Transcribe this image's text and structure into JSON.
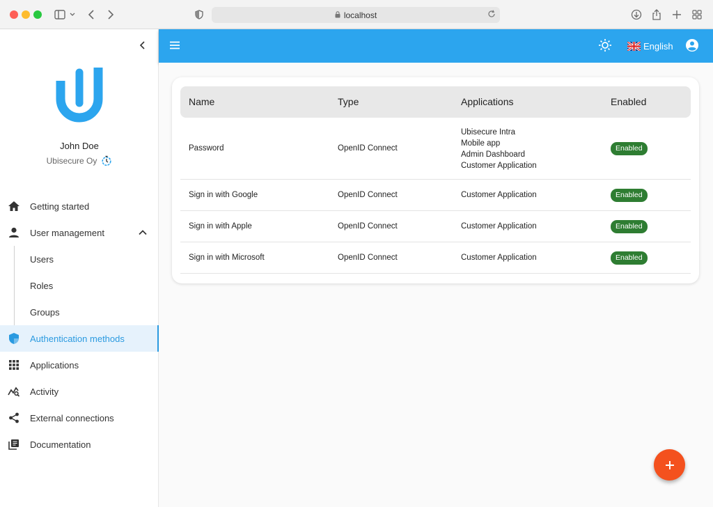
{
  "browser": {
    "url": "localhost"
  },
  "sidebar": {
    "user": {
      "name": "John Doe",
      "organization": "Ubisecure Oy"
    },
    "items": [
      {
        "label": "Getting started",
        "icon": "home-icon"
      },
      {
        "label": "User management",
        "icon": "person-icon",
        "expanded": true
      },
      {
        "label": "Users"
      },
      {
        "label": "Roles"
      },
      {
        "label": "Groups"
      },
      {
        "label": "Authentication methods",
        "icon": "shield-icon",
        "active": true
      },
      {
        "label": "Applications",
        "icon": "apps-grid-icon"
      },
      {
        "label": "Activity",
        "icon": "activity-icon"
      },
      {
        "label": "External connections",
        "icon": "share-icon"
      },
      {
        "label": "Documentation",
        "icon": "library-books-icon"
      }
    ]
  },
  "appbar": {
    "language": "English",
    "color": "#2ca5ee"
  },
  "table": {
    "columns": [
      "Name",
      "Type",
      "Applications",
      "Enabled"
    ],
    "rows": [
      {
        "name": "Password",
        "type": "OpenID Connect",
        "applications": [
          "Ubisecure Intra",
          "Mobile app",
          "Admin Dashboard",
          "Customer Application"
        ],
        "enabled": "Enabled"
      },
      {
        "name": "Sign in with Google",
        "type": "OpenID Connect",
        "applications": [
          "Customer Application"
        ],
        "enabled": "Enabled"
      },
      {
        "name": "Sign in with Apple",
        "type": "OpenID Connect",
        "applications": [
          "Customer Application"
        ],
        "enabled": "Enabled"
      },
      {
        "name": "Sign in with Microsoft",
        "type": "OpenID Connect",
        "applications": [
          "Customer Application"
        ],
        "enabled": "Enabled"
      }
    ]
  },
  "colors": {
    "accent": "#2ca5ee",
    "active_nav": "#2a9ae0",
    "badge": "#2e7d32",
    "fab": "#f4511e"
  }
}
